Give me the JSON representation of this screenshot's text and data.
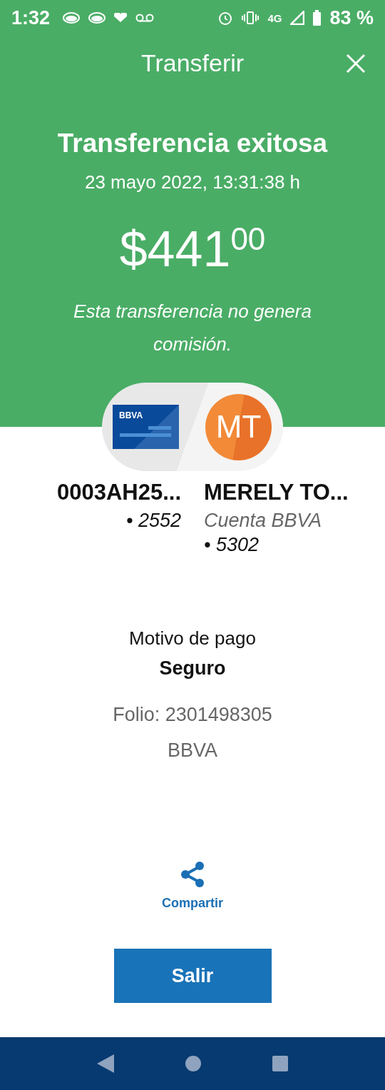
{
  "status_bar": {
    "time": "1:32",
    "network": "4G",
    "battery": "83 %"
  },
  "header": {
    "title": "Transferir"
  },
  "result": {
    "title": "Transferencia exitosa",
    "date": "23 mayo 2022, 13:31:38 h",
    "amount": "$441$^{00}$",
    "note": "Esta transferencia no genera comisión."
  },
  "source": {
    "card_brand": "BBVA",
    "name": "0003AH25...",
    "account": "• 2552"
  },
  "destination": {
    "initials": "MT",
    "name": "MERELY TO...",
    "bank": "Cuenta BBVA",
    "account": "• 5302"
  },
  "details": {
    "label": "Motivo de pago",
    "value": "Seguro",
    "folio": "Folio: 2301498305",
    "bank": "BBVA"
  },
  "share": {
    "label": "Compartir"
  },
  "exit_button": {
    "label": "Salir"
  }
}
